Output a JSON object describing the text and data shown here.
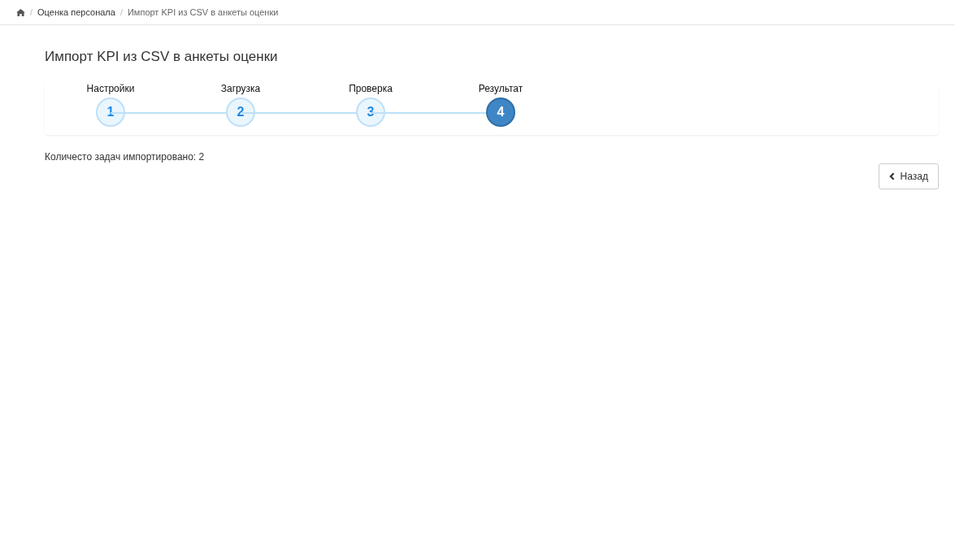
{
  "breadcrumb": [
    {
      "separator": "/",
      "label": "Оценка персонала"
    },
    {
      "separator": "/",
      "label": "Импорт KPI из CSV в анкеты оценки"
    }
  ],
  "title": "Импорт KPI из CSV в анкеты оценки",
  "steps": [
    {
      "label": "Настройки",
      "number": "1",
      "selected": false
    },
    {
      "label": "Загрузка",
      "number": "2",
      "selected": false
    },
    {
      "label": "Проверка",
      "number": "3",
      "selected": false
    },
    {
      "label": "Результат",
      "number": "4",
      "selected": true
    }
  ],
  "result_text": "Количесто задач импортировано: 2",
  "back_button": "Назад"
}
